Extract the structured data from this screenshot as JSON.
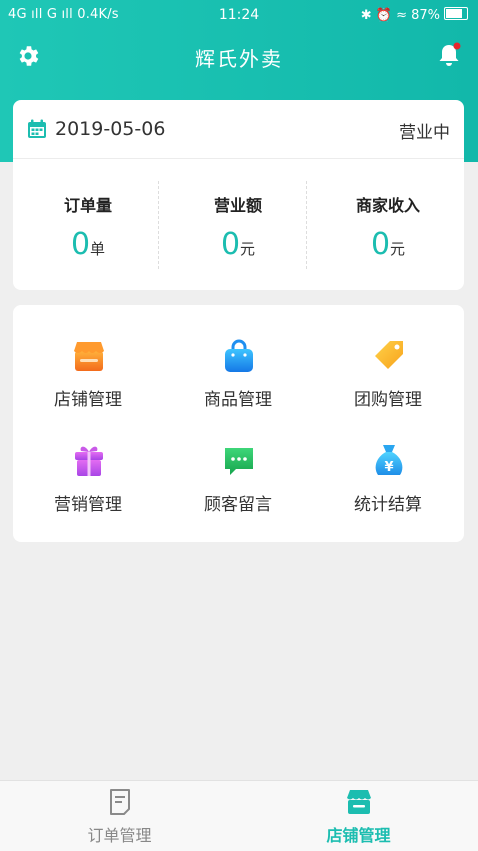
{
  "status_bar": {
    "left": "4G ıll G ıll 0.4K/s",
    "time": "11:24",
    "right": "✱ ⏰ ≈ 87%"
  },
  "header": {
    "title": "辉氏外卖",
    "settings_icon": "gear-icon",
    "notification_icon": "bell-icon",
    "accent": "#1fc7b6"
  },
  "business": {
    "date": "2019-05-06",
    "status": "营业中"
  },
  "stats": [
    {
      "label": "订单量",
      "value": "0",
      "unit": "单"
    },
    {
      "label": "营业额",
      "value": "0",
      "unit": "元"
    },
    {
      "label": "商家收入",
      "value": "0",
      "unit": "元"
    }
  ],
  "menu": [
    {
      "label": "店铺管理",
      "icon": "store-icon"
    },
    {
      "label": "商品管理",
      "icon": "shopping-bag-icon"
    },
    {
      "label": "团购管理",
      "icon": "price-tag-icon"
    },
    {
      "label": "营销管理",
      "icon": "gift-icon"
    },
    {
      "label": "顾客留言",
      "icon": "message-icon"
    },
    {
      "label": "统计结算",
      "icon": "money-bag-icon"
    }
  ],
  "tabs": [
    {
      "label": "订单管理",
      "icon": "order-icon",
      "active": false
    },
    {
      "label": "店铺管理",
      "icon": "store-icon",
      "active": true
    }
  ]
}
